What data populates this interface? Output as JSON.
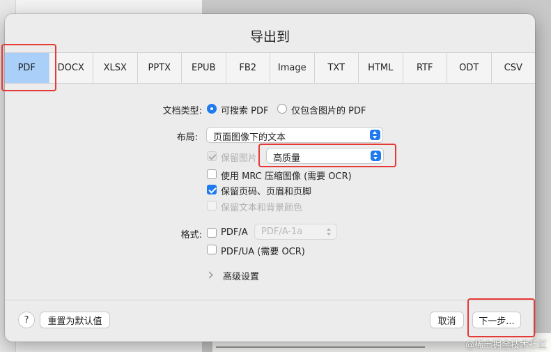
{
  "dialog": {
    "title": "导出到"
  },
  "tabs": [
    {
      "label": "PDF",
      "active": true
    },
    {
      "label": "DOCX"
    },
    {
      "label": "XLSX"
    },
    {
      "label": "PPTX"
    },
    {
      "label": "EPUB"
    },
    {
      "label": "FB2"
    },
    {
      "label": "Image"
    },
    {
      "label": "TXT"
    },
    {
      "label": "HTML"
    },
    {
      "label": "RTF"
    },
    {
      "label": "ODT"
    },
    {
      "label": "CSV"
    }
  ],
  "doc_type": {
    "label": "文档类型:",
    "options": [
      {
        "label": "可搜索 PDF",
        "selected": true
      },
      {
        "label": "仅包含图片的 PDF",
        "selected": false
      }
    ]
  },
  "layout": {
    "label": "布局:",
    "value": "页面图像下的文本"
  },
  "options": {
    "keep_images": {
      "label": "保留图片",
      "checked": true,
      "enabled": false
    },
    "image_quality": {
      "value": "高质量"
    },
    "mrc": {
      "label": "使用 MRC 压缩图像 (需要 OCR)",
      "checked": false
    },
    "keep_headers": {
      "label": "保留页码、页眉和页脚",
      "checked": true
    },
    "keep_colors": {
      "label": "保留文本和背景颜色",
      "checked": false,
      "enabled": false
    }
  },
  "format": {
    "label": "格式:",
    "pdfa": {
      "label": "PDF/A",
      "checked": false
    },
    "pdfa_version": {
      "value": "PDF/A-1a"
    },
    "pdfua": {
      "label": "PDF/UA (需要 OCR)",
      "checked": false
    }
  },
  "advanced": {
    "label": "高级设置"
  },
  "footer": {
    "help": "?",
    "reset": "重置为默认值",
    "cancel": "取消",
    "next": "下一步..."
  },
  "watermark": "@稀土掘金技术社区",
  "colors": {
    "accent": "#1f7aef",
    "tab_active": "#aad0f9",
    "annotation": "#e53935"
  }
}
